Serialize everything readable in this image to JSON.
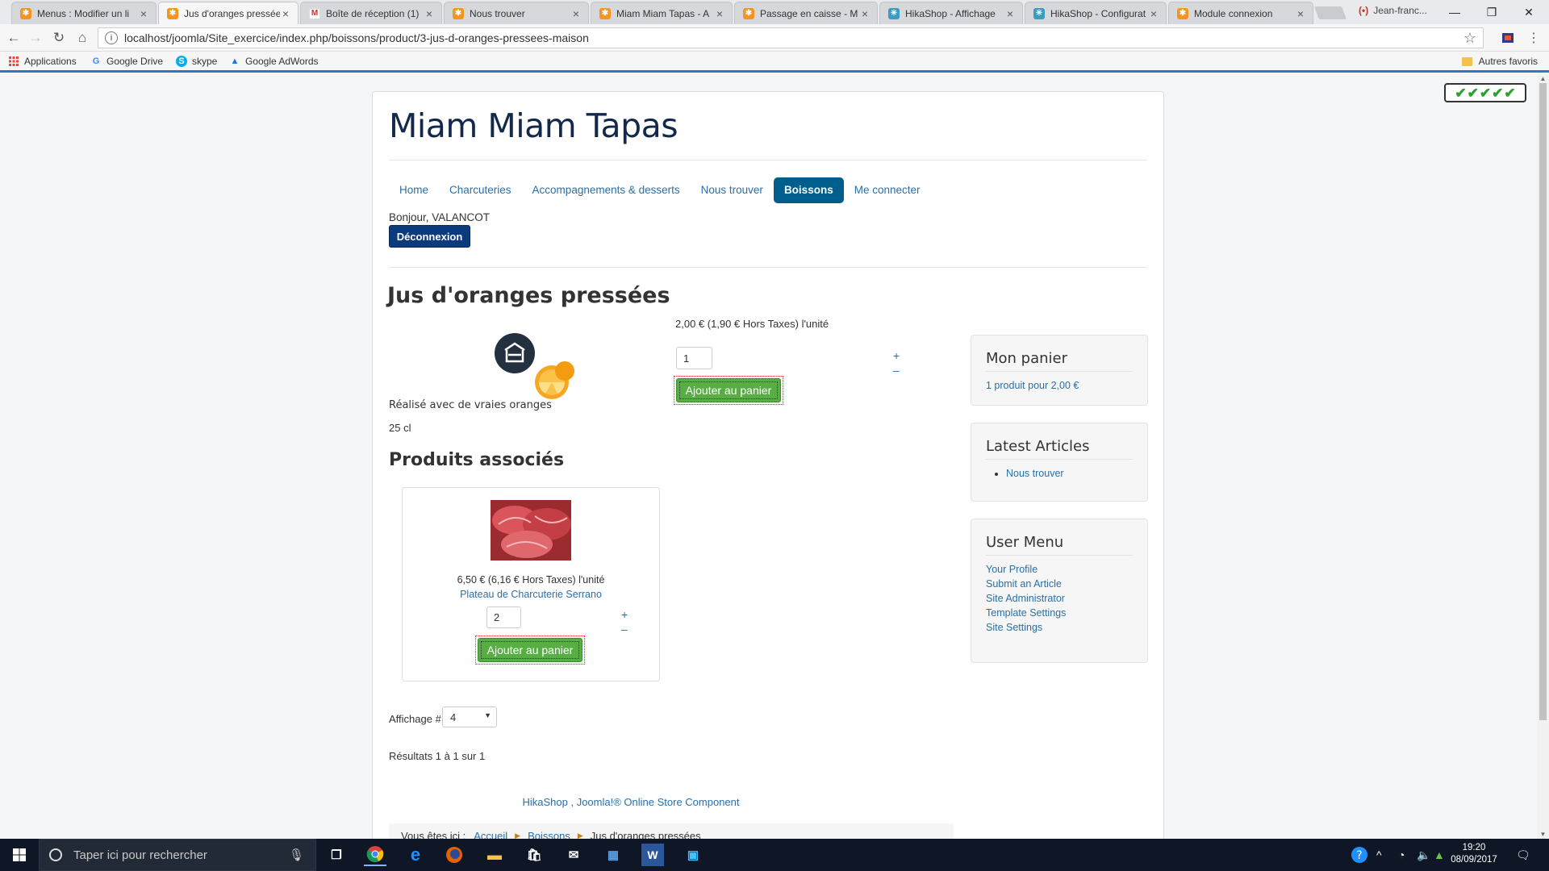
{
  "browser": {
    "tabs": [
      {
        "title": "Menus : Modifier un li",
        "favicon": "joomla-icon"
      },
      {
        "title": "Jus d'oranges pressée",
        "favicon": "joomla-icon"
      },
      {
        "title": "Boîte de réception (1)",
        "favicon": "gmail-icon"
      },
      {
        "title": "Nous trouver",
        "favicon": "joomla-icon"
      },
      {
        "title": "Miam Miam Tapas - A",
        "favicon": "joomla-icon"
      },
      {
        "title": "Passage en caisse - M",
        "favicon": "joomla-icon"
      },
      {
        "title": "HikaShop - Affichage",
        "favicon": "hikashop-icon"
      },
      {
        "title": "HikaShop - Configurat",
        "favicon": "hikashop-icon"
      },
      {
        "title": "Module connexion",
        "favicon": "joomla-icon"
      }
    ],
    "user_chip": "Jean-franc...",
    "url": "localhost/joomla/Site_exercice/index.php/boissons/product/3-jus-d-oranges-pressees-maison",
    "bookmarks": [
      "Applications",
      "Google Drive",
      "skype",
      "Google AdWords"
    ],
    "other_bookmarks": "Autres favoris"
  },
  "site": {
    "title": "Miam Miam Tapas",
    "nav": [
      "Home",
      "Charcuteries",
      "Accompagnements & desserts",
      "Nous trouver",
      "Boissons",
      "Me connecter"
    ],
    "active_nav": "Boissons",
    "greeting": "Bonjour, VALANCOT",
    "logout_label": "Déconnexion"
  },
  "product": {
    "name": "Jus d'oranges pressées",
    "price_text": "2,00 € (1,90 € Hors Taxes) l'unité",
    "quantity": "1",
    "plus": "+",
    "minus": "–",
    "add_to_cart": "Ajouter au panier",
    "description": "Réalisé avec de vraies oranges",
    "volume": "25 cl"
  },
  "related": {
    "heading": "Produits associés",
    "items": [
      {
        "price_text": "6,50 € (6,16 € Hors Taxes) l'unité",
        "name": "Plateau de Charcuterie Serrano",
        "quantity": "2",
        "add_to_cart": "Ajouter au panier"
      }
    ],
    "display_label": "Affichage #",
    "display_value": "4",
    "results": "Résultats 1 à 1 sur 1"
  },
  "footer": {
    "credit": "HikaShop , Joomla!® Online Store Component",
    "breadcrumb_prefix": "Vous êtes ici :",
    "breadcrumb": [
      "Accueil",
      "Boissons",
      "Jus d'oranges pressées"
    ]
  },
  "sidebar": {
    "cart": {
      "title": "Mon panier",
      "summary": "1 produit pour 2,00 €"
    },
    "latest": {
      "title": "Latest Articles",
      "items": [
        "Nous trouver"
      ]
    },
    "user_menu": {
      "title": "User Menu",
      "items": [
        "Your Profile",
        "Submit an Article",
        "Site Administrator",
        "Template Settings",
        "Site Settings"
      ]
    }
  },
  "taskbar": {
    "search_placeholder": "Taper ici pour rechercher",
    "time": "19:20",
    "date": "08/09/2017"
  },
  "colors": {
    "accent": "#005e8d",
    "title": "#13294b",
    "cart_button": "#58ad45",
    "link": "#2a6fa8"
  }
}
